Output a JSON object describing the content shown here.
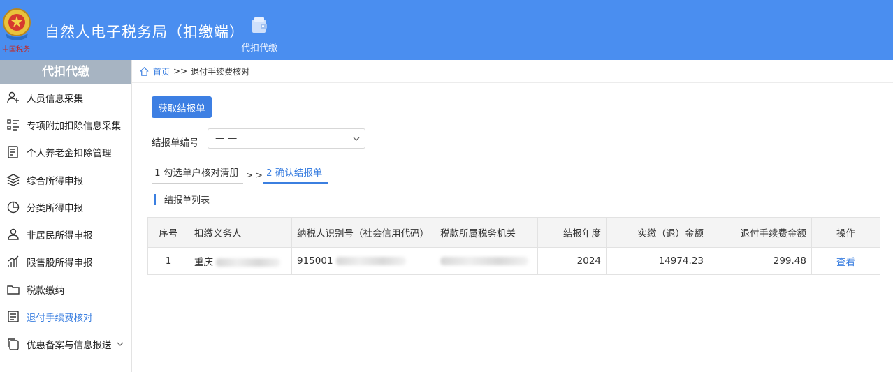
{
  "header": {
    "title": "自然人电子税务局（扣缴端）",
    "emblem_text": "中国税务",
    "nav": [
      {
        "label": "代扣代缴",
        "icon": "wallet-icon"
      }
    ]
  },
  "sidebar": {
    "title": "代扣代缴",
    "items": [
      {
        "label": "人员信息采集",
        "icon": "person-add-icon"
      },
      {
        "label": "专项附加扣除信息采集",
        "icon": "list-icon"
      },
      {
        "label": "个人养老金扣除管理",
        "icon": "document-icon"
      },
      {
        "label": "综合所得申报",
        "icon": "layers-icon"
      },
      {
        "label": "分类所得申报",
        "icon": "pie-chart-icon"
      },
      {
        "label": "非居民所得申报",
        "icon": "person-icon"
      },
      {
        "label": "限售股所得申报",
        "icon": "bar-chart-icon"
      },
      {
        "label": "税款缴纳",
        "icon": "folder-icon"
      },
      {
        "label": "退付手续费核对",
        "icon": "checklist-icon",
        "active": true
      },
      {
        "label": "优惠备案与信息报送",
        "icon": "copy-icon"
      }
    ]
  },
  "breadcrumb": {
    "home": "首页",
    "separator": ">>",
    "current": "退付手续费核对"
  },
  "toolbar": {
    "fetch_button": "获取结报单"
  },
  "form": {
    "report_no_label": "结报单编号",
    "report_no_value": "— —"
  },
  "steps": {
    "step1": "1 勾选单户核对清册",
    "separator": "> >",
    "step2": "2 确认结报单"
  },
  "section": {
    "title": "结报单列表"
  },
  "table": {
    "headers": [
      "序号",
      "扣缴义务人",
      "纳税人识别号（社会信用代码）",
      "税款所属税务机关",
      "结报年度",
      "实缴（退）金额",
      "退付手续费金额",
      "操作"
    ],
    "rows": [
      {
        "index": "1",
        "withholder": "重庆",
        "taxpayer_id": "915001",
        "tax_office": "",
        "year": "2024",
        "paid_amount": "14974.23",
        "fee_amount": "299.48",
        "action": "查看"
      }
    ]
  },
  "colors": {
    "header_bg": "#4a8ef0",
    "accent": "#3b7fe0",
    "sidebar_head_bg": "#a7b4c2"
  }
}
